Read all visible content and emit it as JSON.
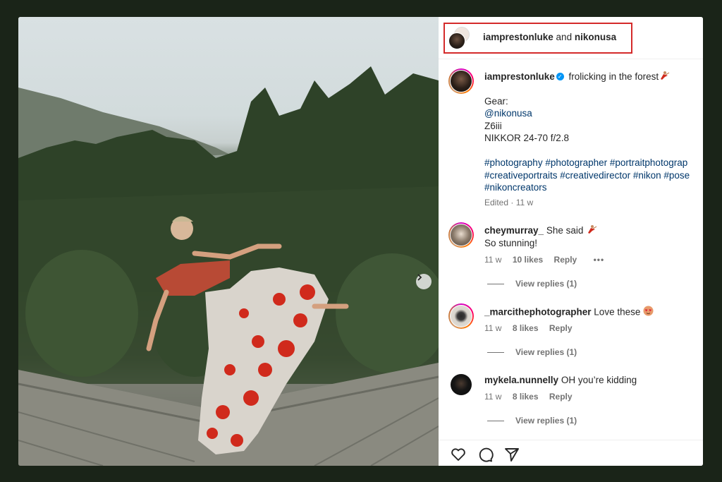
{
  "post": {
    "image": {
      "description": "Woman in red floral off-shoulder dress dancing on a wooden boardwalk in a forest",
      "next_button_label": "Next"
    },
    "header": {
      "author": "iamprestonluke",
      "joiner": "and",
      "collaborator": "nikonusa"
    },
    "caption": {
      "author": "iamprestonluke",
      "verified": true,
      "text": "frolicking in the forest",
      "emoji": "dancer",
      "gear_label": "Gear:",
      "mention": "@nikonusa",
      "camera": "Z6iii",
      "lens": "NIKKOR 24-70 f/2.8",
      "hashtags_line1": "#photography #photographer #portraitphotograp",
      "hashtags_line2": "#creativeportraits #creativedirector #nikon #pose",
      "hashtags_line3": "#nikoncreators",
      "edited": "Edited · 11 w"
    },
    "comments": [
      {
        "author": "cheymurray_",
        "text_line1": "She said",
        "emoji": "dancer",
        "text_line2": "So stunning!",
        "age": "11 w",
        "likes": "10 likes",
        "reply_label": "Reply",
        "more_label": "•••",
        "view_replies": "View replies (1)"
      },
      {
        "author": "_marcithephotographer",
        "text_line1": "Love these",
        "emoji": "heart-eyes",
        "age": "11 w",
        "likes": "8 likes",
        "reply_label": "Reply",
        "view_replies": "View replies (1)"
      },
      {
        "author": "mykela.nunnelly",
        "text_line1": "OH you’re kidding",
        "age": "11 w",
        "likes": "8 likes",
        "reply_label": "Reply",
        "view_replies": "View replies (1)"
      }
    ],
    "actions": {
      "like_icon": "heart-icon",
      "comment_icon": "comment-icon",
      "share_icon": "paper-plane-icon"
    },
    "colors": {
      "highlight_box": "#d42a2a",
      "background": "#1a2418",
      "link": "#00376b",
      "verified": "#0095f6"
    }
  }
}
